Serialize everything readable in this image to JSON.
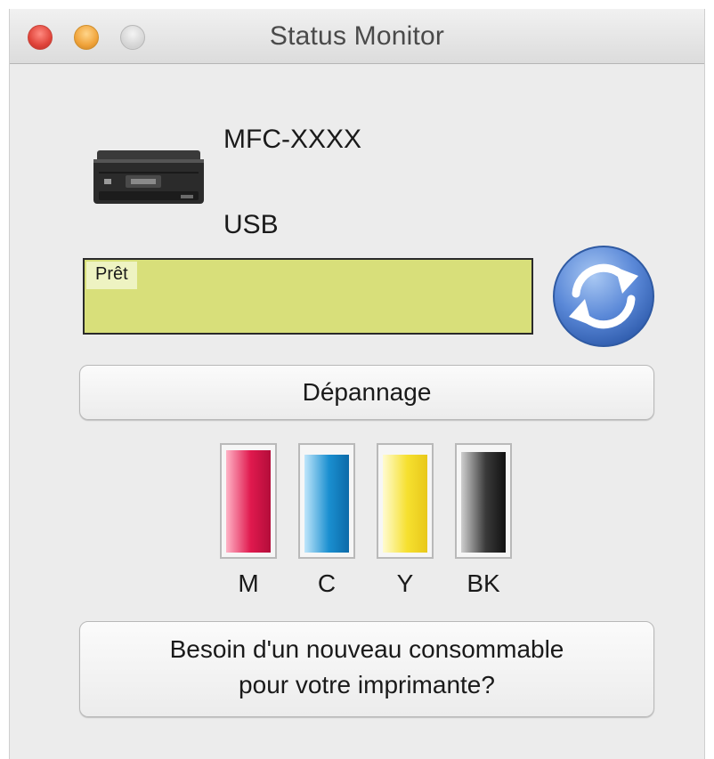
{
  "window": {
    "title": "Status Monitor"
  },
  "device": {
    "model": "MFC-XXXX",
    "connection": "USB"
  },
  "status": {
    "text": "Prêt",
    "color": "#d8df7a"
  },
  "buttons": {
    "troubleshoot": "Dépannage",
    "supplies_line1": "Besoin d'un nouveau consommable",
    "supplies_line2": "pour votre imprimante?"
  },
  "inks": [
    {
      "label": "M",
      "color": "#e0194e",
      "level": 0.97
    },
    {
      "label": "C",
      "color": "#1a8fd0",
      "level": 0.92
    },
    {
      "label": "Y",
      "color": "#f6e02f",
      "level": 0.92
    },
    {
      "label": "BK",
      "color": "#1a1a1a",
      "level": 0.95
    }
  ],
  "icons": {
    "printer": "printer-icon",
    "refresh": "refresh-icon"
  }
}
